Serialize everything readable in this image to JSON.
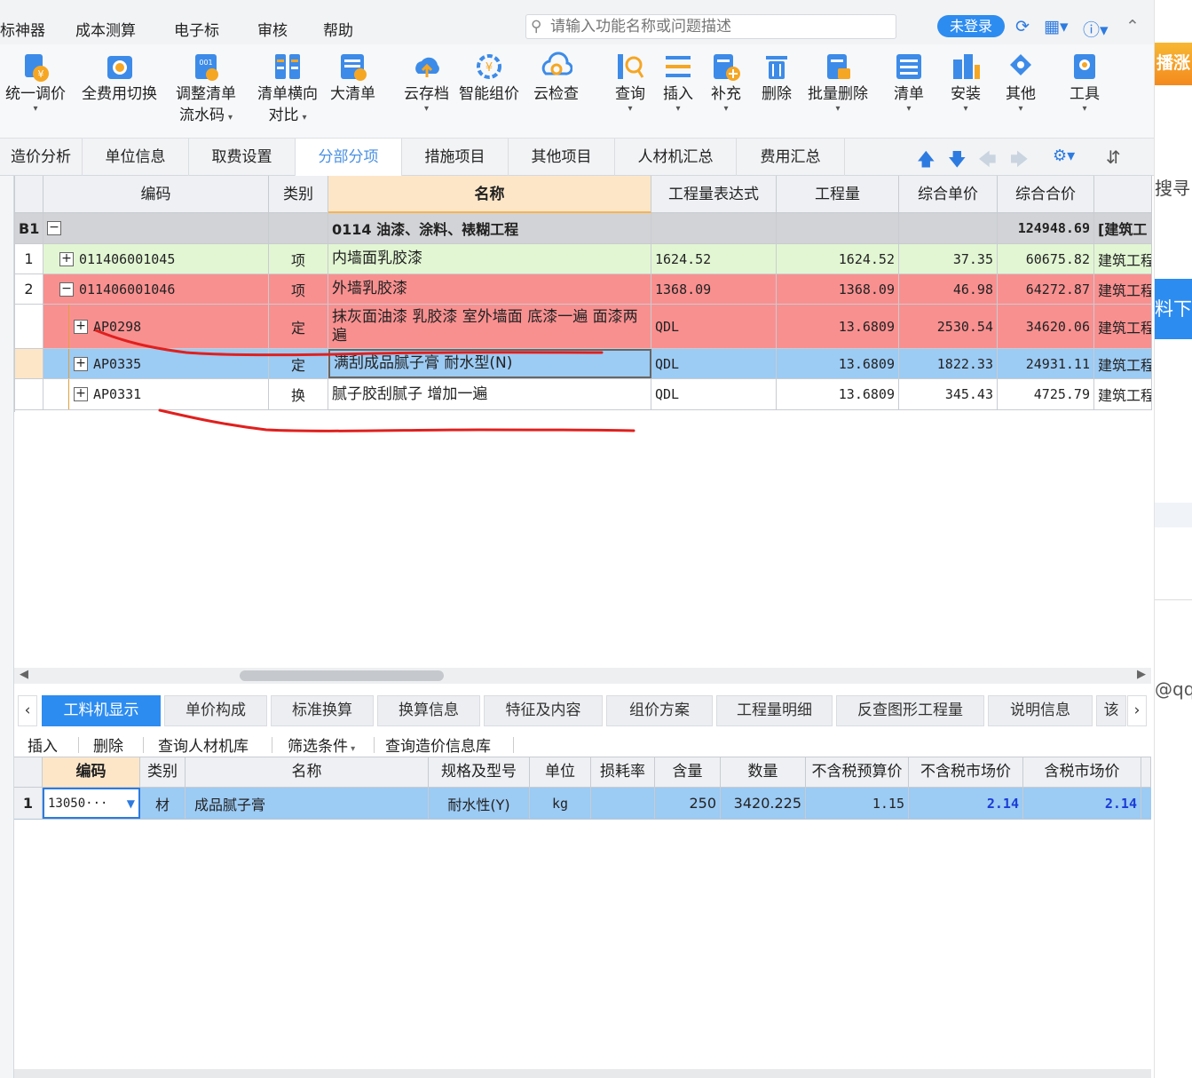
{
  "menubar": {
    "items": [
      "标神器",
      "成本测算",
      "电子标",
      "审核",
      "帮助"
    ],
    "search_placeholder": "请输入功能名称或问题描述",
    "login_label": "未登录"
  },
  "toolbar": {
    "buttons": [
      {
        "label": "统一调价",
        "icon": "unified-price-icon",
        "dropdown": true
      },
      {
        "label": "全费用切换",
        "icon": "full-cost-switch-icon",
        "dropdown": false
      },
      {
        "label": "调整清单",
        "label2": "流水码",
        "icon": "adjust-list-icon",
        "dropdown": true
      },
      {
        "label": "清单横向",
        "label2": "对比",
        "icon": "list-compare-icon",
        "dropdown": true
      },
      {
        "label": "大清单",
        "icon": "big-list-icon",
        "dropdown": false
      },
      {
        "label": "云存档",
        "icon": "cloud-archive-icon",
        "dropdown": true
      },
      {
        "label": "智能组价",
        "icon": "smart-pricing-icon",
        "dropdown": false
      },
      {
        "label": "云检查",
        "icon": "cloud-check-icon",
        "dropdown": false
      },
      {
        "label": "查询",
        "icon": "query-icon",
        "dropdown": true
      },
      {
        "label": "插入",
        "icon": "insert-icon",
        "dropdown": true
      },
      {
        "label": "补充",
        "icon": "supplement-icon",
        "dropdown": true
      },
      {
        "label": "删除",
        "icon": "delete-icon",
        "dropdown": false
      },
      {
        "label": "批量删除",
        "icon": "batch-delete-icon",
        "dropdown": true
      },
      {
        "label": "清单",
        "icon": "list-icon",
        "dropdown": true
      },
      {
        "label": "安装",
        "icon": "install-icon",
        "dropdown": true
      },
      {
        "label": "其他",
        "icon": "other-icon",
        "dropdown": true
      },
      {
        "label": "工具",
        "icon": "tools-icon",
        "dropdown": true
      }
    ]
  },
  "tabs": [
    "造价分析",
    "单位信息",
    "取费设置",
    "分部分项",
    "措施项目",
    "其他项目",
    "人材机汇总",
    "费用汇总"
  ],
  "active_tab": "分部分项",
  "grid": {
    "headers": [
      "编码",
      "类别",
      "名称",
      "工程量表达式",
      "工程量",
      "综合单价",
      "综合合价"
    ],
    "section": {
      "num": "B1",
      "name": "0114 油漆、涂料、裱糊工程",
      "total": "124948.69",
      "spec": "[建筑工"
    },
    "rows": [
      {
        "num": "1",
        "code": "011406001045",
        "type": "项",
        "name": "内墙面乳胶漆",
        "expr": "1624.52",
        "qty": "1624.52",
        "price": "37.35",
        "total": "60675.82",
        "spec": "建筑工程"
      },
      {
        "num": "2",
        "code": "011406001046",
        "type": "项",
        "name": "外墙乳胶漆",
        "expr": "1368.09",
        "qty": "1368.09",
        "price": "46.98",
        "total": "64272.87",
        "spec": "建筑工程"
      },
      {
        "num": "",
        "code": "AP0298",
        "type": "定",
        "name": "抹灰面油漆 乳胶漆 室外墙面 底漆一遍 面漆两遍",
        "expr": "QDL",
        "qty": "13.6809",
        "price": "2530.54",
        "total": "34620.06",
        "spec": "建筑工程"
      },
      {
        "num": "",
        "code": "AP0335",
        "type": "定",
        "name": "满刮成品腻子膏 耐水型(N)",
        "expr": "QDL",
        "qty": "13.6809",
        "price": "1822.33",
        "total": "24931.11",
        "spec": "建筑工程"
      },
      {
        "num": "",
        "code": "AP0331",
        "type": "换",
        "name": "腻子胶刮腻子 增加一遍",
        "expr": "QDL",
        "qty": "13.6809",
        "price": "345.43",
        "total": "4725.79",
        "spec": "建筑工程"
      }
    ]
  },
  "bottom": {
    "tabs": [
      "工料机显示",
      "单价构成",
      "标准换算",
      "换算信息",
      "特征及内容",
      "组价方案",
      "工程量明细",
      "反查图形工程量",
      "说明信息",
      "该"
    ],
    "toolbar": [
      "插入",
      "删除",
      "查询人材机库",
      "筛选条件",
      "查询造价信息库"
    ],
    "headers": [
      "编码",
      "类别",
      "名称",
      "规格及型号",
      "单位",
      "损耗率",
      "含量",
      "数量",
      "不含税预算价",
      "不含税市场价",
      "含税市场价"
    ],
    "row": {
      "num": "1",
      "code": "13050···",
      "type": "材",
      "name": "成品腻子膏",
      "spec": "耐水性(Y)",
      "unit": "kg",
      "loss": "",
      "content": "250",
      "qty": "3420.225",
      "budget": "1.15",
      "market": "2.14",
      "market_tax": "2.14"
    }
  },
  "right_strip": {
    "promo": "播涨",
    "search": "搜寻",
    "download": "料下",
    "qq": "@qq"
  },
  "colors": {
    "accent": "#2d8cf0",
    "row_green": "#e2f6d3",
    "row_red": "#f99090",
    "row_blue": "#9ccbf4",
    "annotation": "#e0201e"
  }
}
